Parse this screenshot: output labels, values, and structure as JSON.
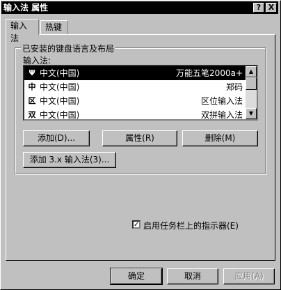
{
  "window": {
    "title": "输入法 属性"
  },
  "titlebar_buttons": {
    "help": "?",
    "close": "X"
  },
  "tabs": [
    {
      "label": "输入法",
      "active": true
    },
    {
      "label": "热键",
      "active": false
    }
  ],
  "group": {
    "title": "已安装的键盘语言及布局",
    "list_label": "输入法:"
  },
  "ime_list": [
    {
      "icon": "Ψ",
      "language": "中文(中国)",
      "ime": "万能五笔2000a+",
      "selected": true
    },
    {
      "icon": "中",
      "language": "中文(中国)",
      "ime": "郑码",
      "selected": false
    },
    {
      "icon": "区",
      "language": "中文(中国)",
      "ime": "区位输入法",
      "selected": false
    },
    {
      "icon": "双",
      "language": "中文(中国)",
      "ime": "双拼输入法",
      "selected": false
    }
  ],
  "scroll_arrows": {
    "up": "▲",
    "down": "▼"
  },
  "buttons": {
    "add": "添加(D)...",
    "properties": "属性(R)",
    "remove": "删除(M)",
    "add_3x": "添加 3.x 输入法(3)..."
  },
  "taskbar_indicator": {
    "label": "启用任务栏上的指示器(E)",
    "checked": true,
    "mark": "✓"
  },
  "footer": {
    "ok": "确定",
    "cancel": "取消",
    "apply": "应用(A)"
  }
}
